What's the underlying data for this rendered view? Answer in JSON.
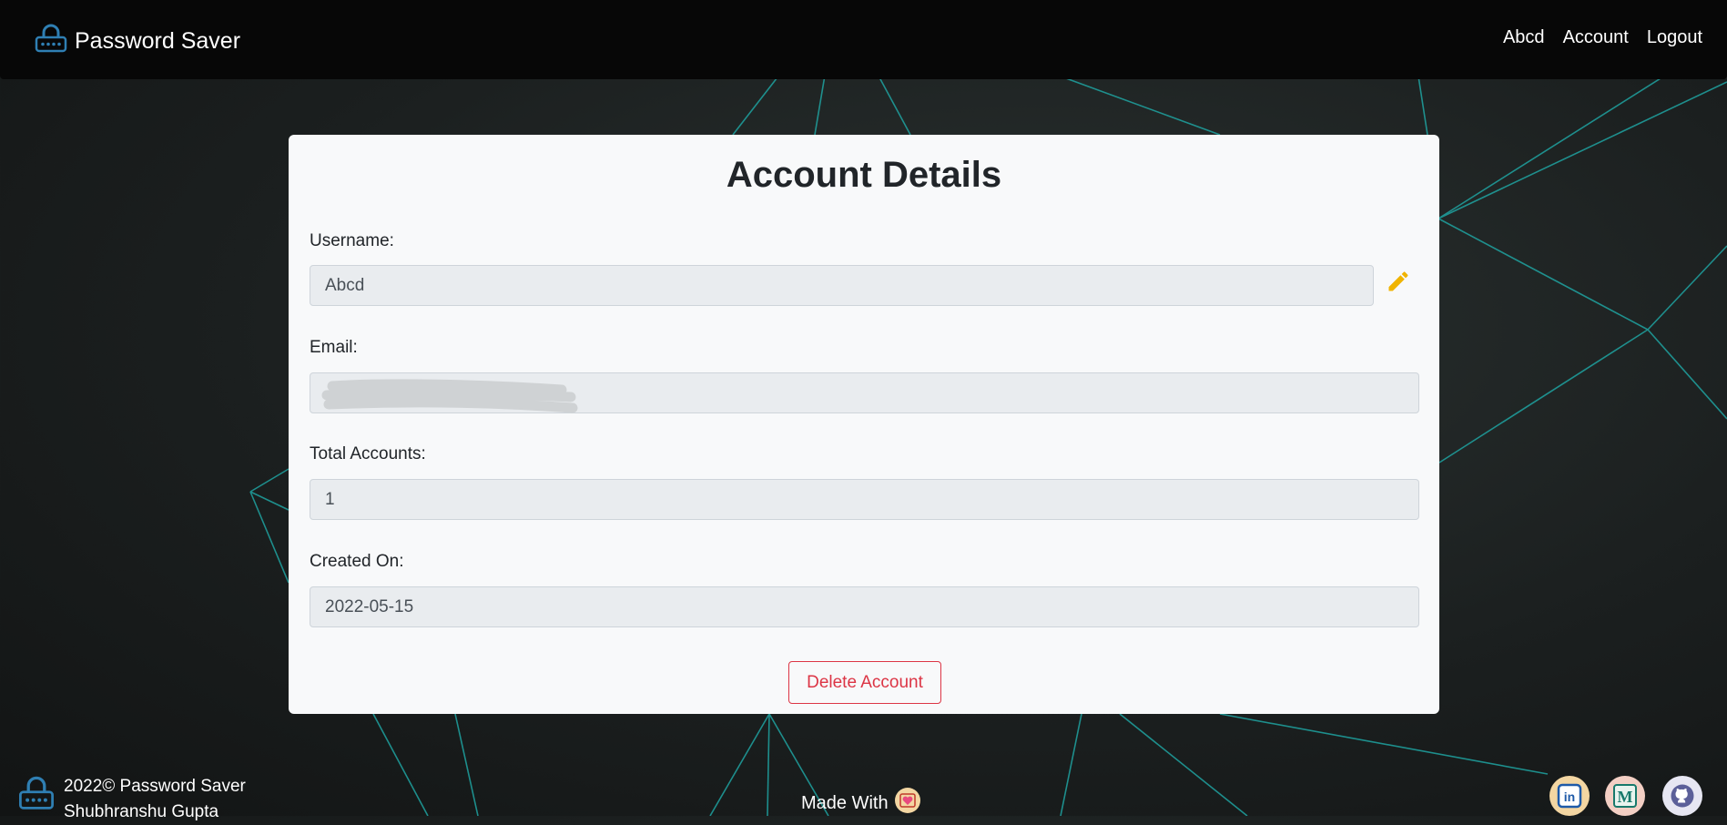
{
  "header": {
    "brand": "Password Saver",
    "nav": [
      "Abcd",
      "Account",
      "Logout"
    ]
  },
  "card": {
    "title": "Account Details",
    "fields": [
      {
        "label": "Username:",
        "value": "Abcd"
      },
      {
        "label": "Email:",
        "value": ""
      },
      {
        "label": "Total Accounts:",
        "value": "1"
      },
      {
        "label": "Created On:",
        "value": "2022-05-15"
      }
    ],
    "delete_label": "Delete Account"
  },
  "footer": {
    "copyright": "2022© Password Saver",
    "author": "Shubhranshu Gupta",
    "made_with": "Made With"
  },
  "colors": {
    "accent_edit": "#f0b400",
    "danger": "#dc3545",
    "line": "#1fa3a1"
  },
  "icons": [
    "lock-icon",
    "pencil-icon",
    "heart-icon",
    "linkedin-icon",
    "medium-icon",
    "github-icon"
  ]
}
